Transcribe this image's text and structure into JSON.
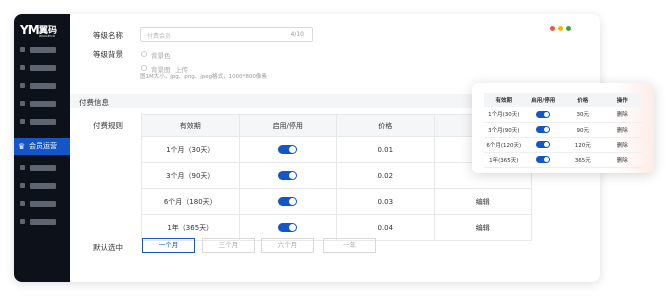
{
  "logo": {
    "mark": "YM",
    "cn": "翼码",
    "en": "IMAGECO"
  },
  "sidebar": {
    "active_label": "会员运营",
    "active_icon": "crown-icon"
  },
  "window_dots": [
    "#ef5350",
    "#ffb300",
    "#43a047"
  ],
  "form": {
    "level_name_label": "等级名称",
    "level_name_placeholder": "付费会员",
    "level_name_count": "4/10",
    "background_label": "等级背景",
    "bg_color_option": "背景色",
    "bg_image_option": "背景图",
    "upload_label": "上传",
    "upload_hint": "图1M大小，jpg、png、jpeg格式，1000*800像素"
  },
  "section": {
    "title": "付费信息"
  },
  "rules": {
    "label": "付费规则",
    "columns": [
      "有效期",
      "启用/停用",
      "价格",
      "操作"
    ],
    "rows": [
      {
        "period": "1个月（30天）",
        "enabled": true,
        "price": "0.01",
        "action": ""
      },
      {
        "period": "3个月（90天）",
        "enabled": true,
        "price": "0.02",
        "action": ""
      },
      {
        "period": "6个月（180天）",
        "enabled": true,
        "price": "0.03",
        "action": "编辑"
      },
      {
        "period": "1年（365天）",
        "enabled": true,
        "price": "0.04",
        "action": "编辑"
      }
    ]
  },
  "default_select": {
    "label": "默认选中",
    "options": [
      "一个月",
      "三个月",
      "六个月",
      "一年"
    ],
    "selected": "一个月"
  },
  "popup": {
    "columns": [
      "有效期",
      "启用/停用",
      "价格",
      "操作"
    ],
    "rows": [
      {
        "period": "1个月(30天)",
        "enabled": true,
        "price": "30元",
        "action": "删除"
      },
      {
        "period": "3个月(90天)",
        "enabled": true,
        "price": "90元",
        "action": "删除"
      },
      {
        "period": "6个月(120天)",
        "enabled": true,
        "price": "120元",
        "action": "删除"
      },
      {
        "period": "1年(365天)",
        "enabled": true,
        "price": "365元",
        "action": "删除"
      }
    ]
  },
  "accent_color": "#1455c8"
}
